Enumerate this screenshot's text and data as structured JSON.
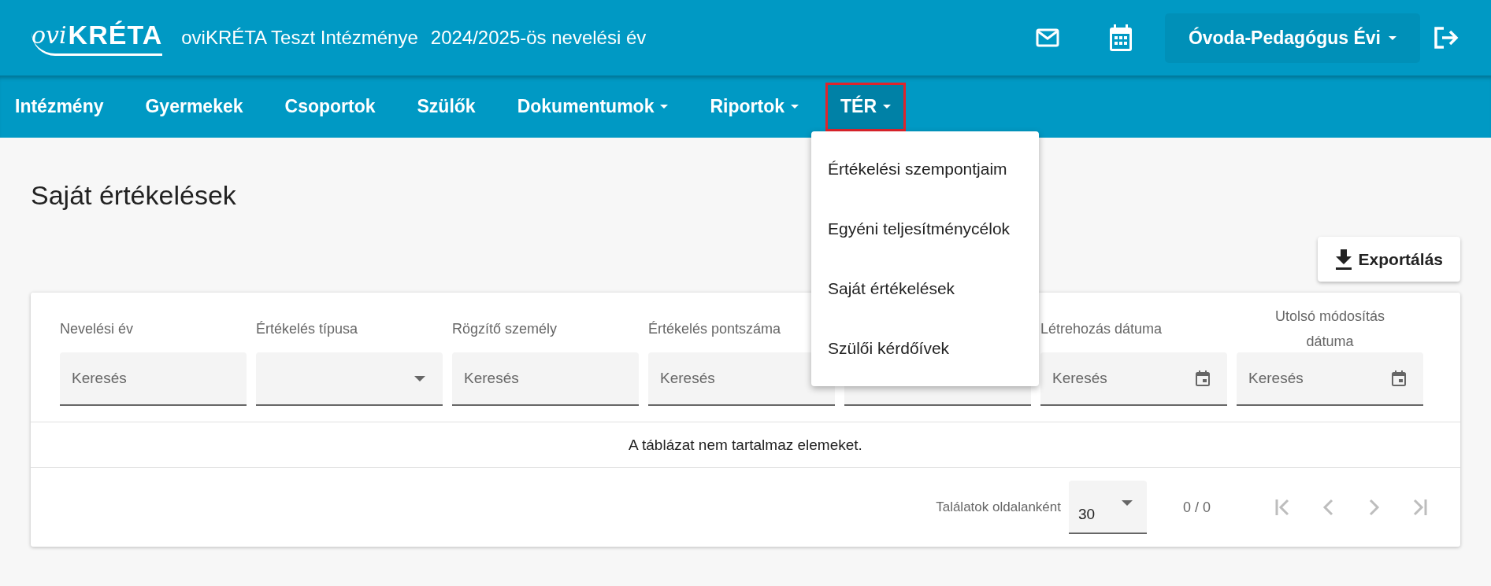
{
  "header": {
    "logo_prefix": "ovi",
    "logo_main": "KRÉTA",
    "institution": "oviKRÉTA Teszt Intézménye",
    "school_year": "2024/2025-ös nevelési év",
    "user": "Óvoda-Pedagógus Évi"
  },
  "nav": [
    {
      "label": "Intézmény",
      "has_menu": false,
      "selected": false,
      "outlined": false
    },
    {
      "label": "Gyermekek",
      "has_menu": false,
      "selected": false,
      "outlined": false
    },
    {
      "label": "Csoportok",
      "has_menu": false,
      "selected": false,
      "outlined": false
    },
    {
      "label": "Szülők",
      "has_menu": false,
      "selected": false,
      "outlined": false
    },
    {
      "label": "Dokumentumok",
      "has_menu": true,
      "selected": false,
      "outlined": false
    },
    {
      "label": "Riportok",
      "has_menu": true,
      "selected": false,
      "outlined": false
    },
    {
      "label": "TÉR",
      "has_menu": true,
      "selected": true,
      "outlined": true
    }
  ],
  "menu": {
    "items": [
      {
        "label": "Értékelési szempontjaim"
      },
      {
        "label": "Egyéni teljesítménycélok"
      },
      {
        "label": "Saját értékelések"
      },
      {
        "label": "Szülői kérdőívek"
      }
    ]
  },
  "page_title": "Saját értékelések",
  "export_button": "Exportálás",
  "table": {
    "columns": [
      {
        "label": "Nevelési év",
        "kind": "text",
        "placeholder": "Keresés"
      },
      {
        "label": "Értékelés típusa",
        "kind": "select"
      },
      {
        "label": "Rögzítő személy",
        "kind": "text",
        "placeholder": "Keresés"
      },
      {
        "label": "Értékelés pontszáma",
        "kind": "text",
        "placeholder": "Keresés"
      },
      {
        "kind": "text"
      },
      {
        "label": "Létrehozás dátuma",
        "kind": "date",
        "placeholder": "Keresés"
      },
      {
        "label": "Utolsó módosítás dátuma",
        "kind": "date",
        "placeholder": "Keresés"
      }
    ],
    "empty_message": "A táblázat nem tartalmaz elemeket.",
    "pagination": {
      "label": "Találatok oldalanként",
      "page_size": "30",
      "range": "0 / 0"
    }
  }
}
